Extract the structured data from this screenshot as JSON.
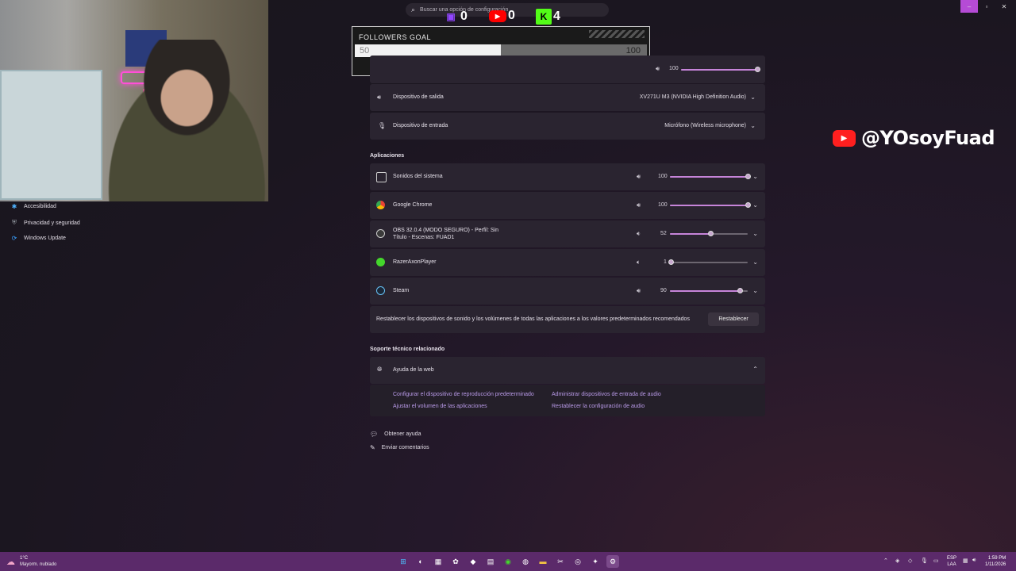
{
  "webcam": {
    "label": "webcam"
  },
  "search": {
    "placeholder": "Buscar una opción de configuración"
  },
  "counters": [
    {
      "platform": "twitch",
      "value": "0"
    },
    {
      "platform": "youtube",
      "value": "0"
    },
    {
      "platform": "kick",
      "value": "4"
    }
  ],
  "followers_goal": {
    "title": "FOLLOWERS GOAL",
    "current": "50",
    "target": "100",
    "progress": 0.5
  },
  "sidebar": {
    "items": [
      {
        "label": "Accesibilidad",
        "icon": "accessibility-icon"
      },
      {
        "label": "Privacidad y seguridad",
        "icon": "shield-icon"
      },
      {
        "label": "Windows Update",
        "icon": "update-icon"
      }
    ]
  },
  "master_volume": {
    "value": "100",
    "level": 1.0
  },
  "output_device": {
    "label": "Dispositivo de salida",
    "value": "XV271U M3 (NVIDIA High Definition Audio)"
  },
  "input_device": {
    "label": "Dispositivo de entrada",
    "value": "Micrófono (Wireless microphone)"
  },
  "apps_section": "Aplicaciones",
  "apps": [
    {
      "name": "Sonidos del sistema",
      "line2": "",
      "volume": "100",
      "level": 1.0,
      "icon": "monitor-icon"
    },
    {
      "name": "Google Chrome",
      "line2": "",
      "volume": "100",
      "level": 1.0,
      "icon": "chrome-icon"
    },
    {
      "name": "OBS 32.0.4 (MODO SEGURO) - Perfil: Sin",
      "line2": "Título - Escenas: FUAD1",
      "volume": "52",
      "level": 0.52,
      "icon": "obs-icon"
    },
    {
      "name": "RazerAxonPlayer",
      "line2": "",
      "volume": "1",
      "level": 0.01,
      "icon": "razer-icon"
    },
    {
      "name": "Steam",
      "line2": "",
      "volume": "90",
      "level": 0.9,
      "icon": "steam-icon"
    }
  ],
  "reset": {
    "text": "Restablecer los dispositivos de sonido y los volúmenes de todas las aplicaciones a los valores predeterminados recomendados",
    "button": "Restablecer"
  },
  "support_section": "Soporte técnico relacionado",
  "web_help": {
    "title": "Ayuda de la web",
    "links": [
      "Configurar el dispositivo de reproducción predeterminado",
      "Administrar dispositivos de entrada de audio",
      "Ajustar el volumen de las aplicaciones",
      "Restablecer la configuración de audio"
    ]
  },
  "footer_links": [
    "Obtener ayuda",
    "Enviar comentarios"
  ],
  "brand": {
    "handle": "@YOsoyFuad"
  },
  "weather": {
    "temp": "1°C",
    "desc": "Mayorm. nublado"
  },
  "tray": {
    "lang1": "ESP",
    "lang2": "LAA",
    "time": "1:59 PM",
    "date": "1/11/2026"
  },
  "colors": {
    "accent": "#c684d9",
    "taskbar": "#5b2a6a",
    "card": "#2a2430"
  }
}
